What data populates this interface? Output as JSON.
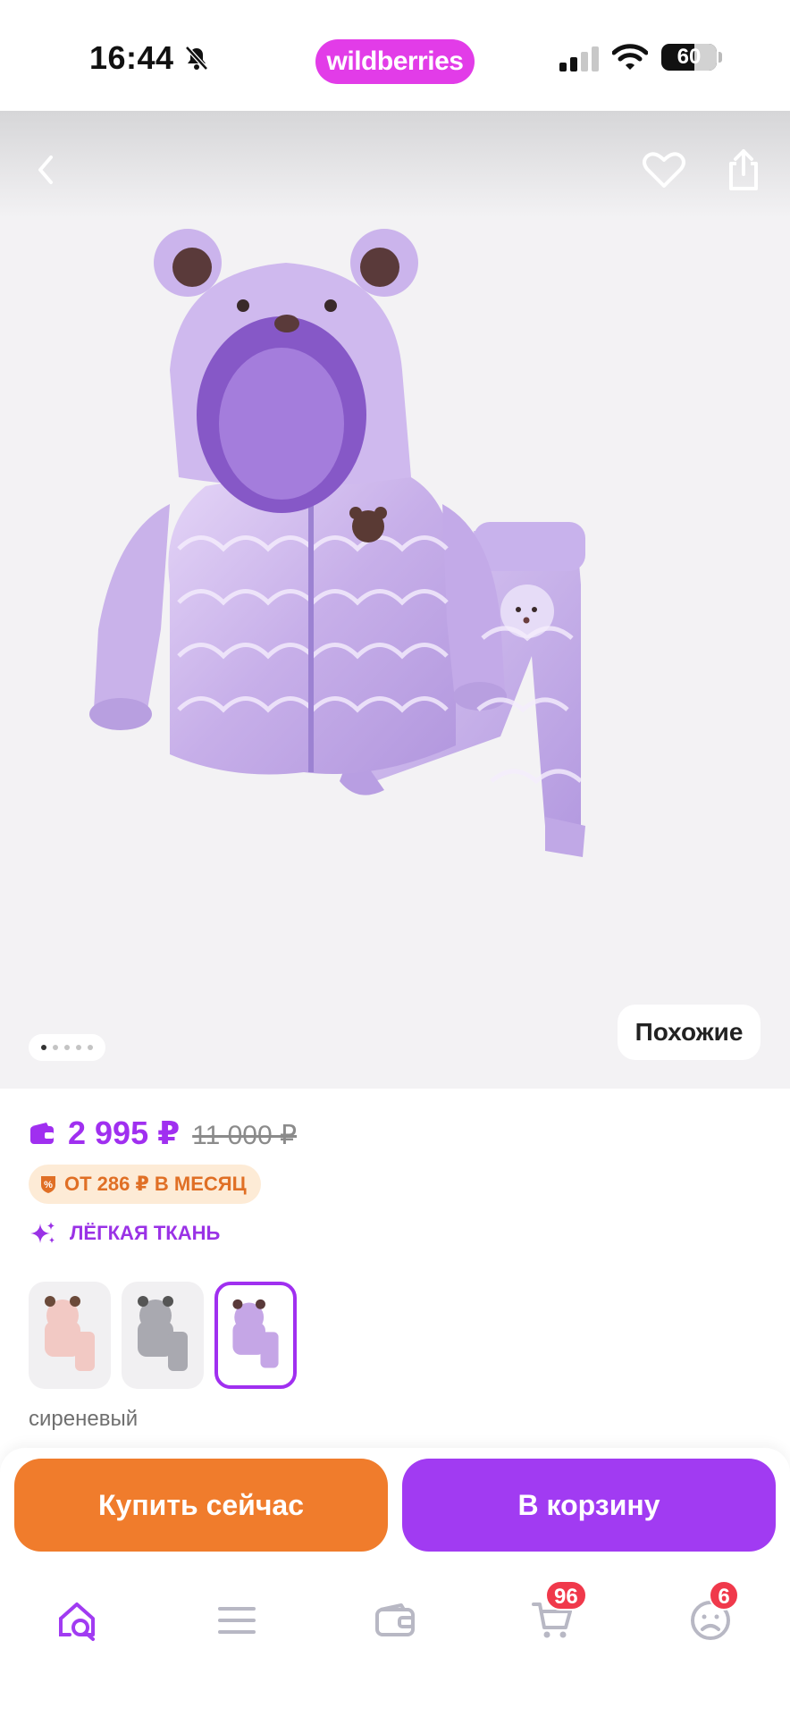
{
  "status_bar": {
    "time": "16:44",
    "brand": "wildberries",
    "battery": "60",
    "battery_level": 0.6
  },
  "icons": {
    "back": "chevron-left-icon",
    "favorite": "heart-icon",
    "share": "share-icon",
    "wallet": "wallet-icon",
    "installment": "percent-shield-icon",
    "feature": "sparkle-icon",
    "home": "home-search-icon",
    "catalog": "menu-icon",
    "wallet_tab": "wallet-icon",
    "cart": "cart-icon",
    "profile": "profile-icon"
  },
  "gallery": {
    "similar_label": "Похожие",
    "pages": 5,
    "current_page": 1
  },
  "product": {
    "price": "2 995 ₽",
    "old_price": "11 000 ₽",
    "installment": "ОТ 286 ₽ В МЕСЯЦ",
    "feature": "ЛЁГКАЯ ТКАНЬ",
    "selected_color": "сиреневый",
    "swatches": [
      {
        "color": "#f2c9c4"
      },
      {
        "color": "#a9a9b0"
      },
      {
        "color": "#c5a6e6"
      }
    ]
  },
  "actions": {
    "buy_now": "Купить сейчас",
    "add_to_cart": "В корзину"
  },
  "tab_bar": {
    "cart_badge": "96",
    "profile_badge": "6"
  },
  "colors": {
    "accent": "#a13bf2",
    "brand": "#e23ce8",
    "orange": "#f07c2c",
    "badge": "#f0394b"
  }
}
